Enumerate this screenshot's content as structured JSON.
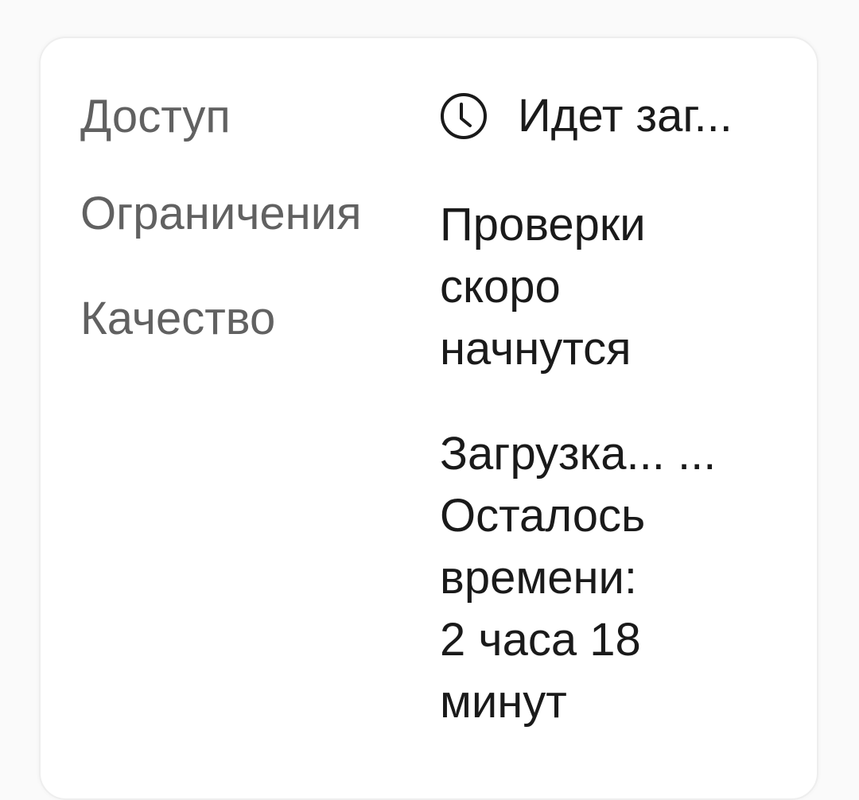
{
  "labels": {
    "access": "Доступ",
    "restrictions": "Ограничения",
    "quality": "Качество"
  },
  "values": {
    "access_icon": "clock-icon",
    "access": "Идет заг...",
    "restrictions_line1": "Проверки",
    "restrictions_line2": "скоро",
    "restrictions_line3": "начнутся",
    "quality_line1": "Загрузка... ...",
    "quality_line2": "Осталось",
    "quality_line3": "времени:",
    "quality_line4": "2 часа 18",
    "quality_line5": "минут"
  }
}
